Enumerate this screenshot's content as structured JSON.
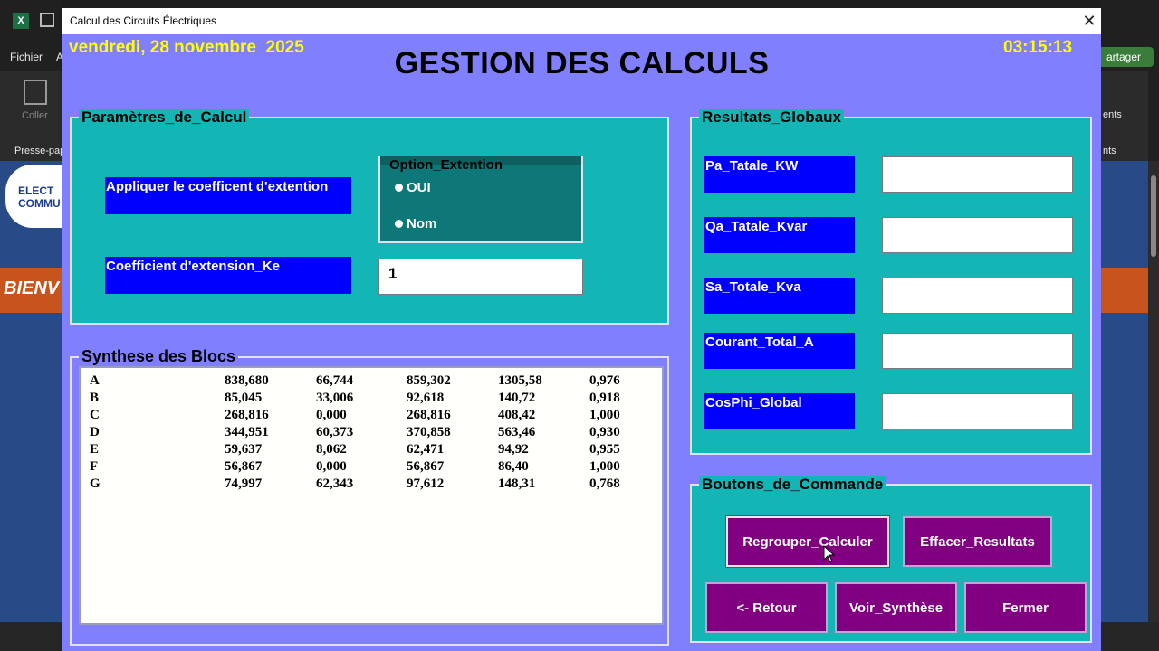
{
  "excel": {
    "menu_file": "Fichier",
    "menu_partial": "A",
    "clipboard_paste": "Coller",
    "clipboard_group": "Presse-pap",
    "share_label": "artager",
    "ribbon_right_1": "ents",
    "ribbon_right_2": "nts",
    "logo_line1": "ELECT",
    "logo_line2": "COMMU",
    "banner_text": "BIENV"
  },
  "dialog": {
    "window_title": "Calcul des Circuits Électriques",
    "date": "vendredi, 28 novembre  2025",
    "time": "03:15:13",
    "main_title": "GESTION DES CALCULS"
  },
  "parametres": {
    "frame_title": "Paramètres_de_Calcul",
    "apply_label": "Appliquer le coefficent d'extention",
    "coef_label": "Coefficient d'extension_Ke",
    "coef_value": "1",
    "option_frame_title": "Option_Extention",
    "option_yes": "OUI",
    "option_no": "Nom"
  },
  "synthese": {
    "frame_title": "Synthese des Blocs",
    "rows": [
      [
        "A",
        "838,680",
        "66,744",
        "859,302",
        "1305,58",
        "0,976"
      ],
      [
        "B",
        "85,045",
        "33,006",
        "92,618",
        "140,72",
        "0,918"
      ],
      [
        "C",
        "268,816",
        "0,000",
        "268,816",
        "408,42",
        "1,000"
      ],
      [
        "D",
        "344,951",
        "60,373",
        "370,858",
        "563,46",
        "0,930"
      ],
      [
        "E",
        "59,637",
        "8,062",
        "62,471",
        "94,92",
        "0,955"
      ],
      [
        "F",
        "56,867",
        "0,000",
        "56,867",
        "86,40",
        "1,000"
      ],
      [
        "G",
        "74,997",
        "62,343",
        "97,612",
        "148,31",
        "0,768"
      ]
    ]
  },
  "resultats": {
    "frame_title": "Resultats_Globaux",
    "fields": [
      {
        "label": "Pa_Tatale_KW",
        "value": ""
      },
      {
        "label": "Qa_Tatale_Kvar",
        "value": ""
      },
      {
        "label": "Sa_Totale_Kva",
        "value": ""
      },
      {
        "label": "Courant_Total_A",
        "value": ""
      },
      {
        "label": "CosPhi_Global",
        "value": ""
      }
    ]
  },
  "boutons": {
    "frame_title": "Boutons_de_Commande",
    "regrouper": "Regrouper_Calculer",
    "effacer": "Effacer_Resultats",
    "retour": "<- Retour",
    "voir": "Voir_Synthèse",
    "fermer": "Fermer"
  },
  "colors": {
    "dialog_bg": "#8080ff",
    "frame_bg": "#14b5b5",
    "label_bg": "#0000ff",
    "button_bg": "#800080",
    "clock_text": "#ffff00"
  }
}
